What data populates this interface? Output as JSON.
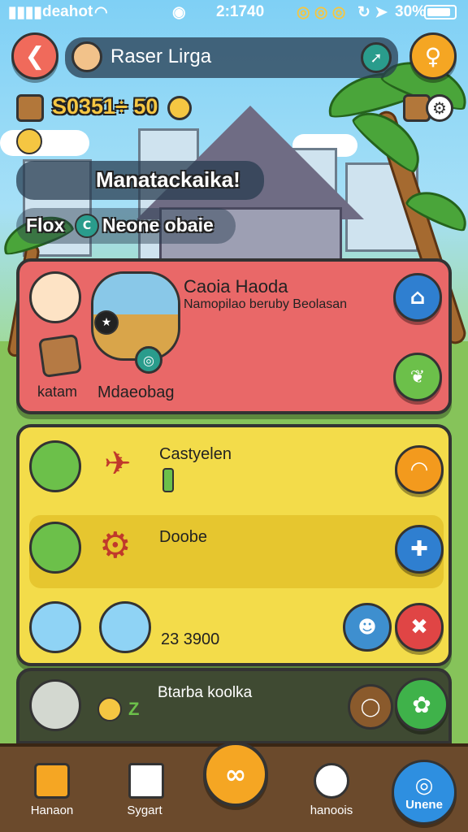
{
  "status_bar": {
    "carrier": "deahot",
    "time": "2:1740",
    "battery": "30%"
  },
  "header": {
    "player_name": "Raser Lirga",
    "back_icon": "chevron-left-icon",
    "profile_icon": "map-pin-icon"
  },
  "resources": {
    "coins": "S0351÷ 50"
  },
  "banner": {
    "title": "Manatackaika!",
    "subtitle": "Flox",
    "subtitle_tag": "Neone obaie"
  },
  "featured_card": {
    "title": "Caoia Haoda",
    "subtitle": "Namopilao beruby Beolasan",
    "item_left_label": "katam",
    "item_right_label": "Mdaeobag",
    "color": "#e96868"
  },
  "list": [
    {
      "name": "Castyelen",
      "value": "",
      "action_icon": "wifi-icon",
      "action_color": "#f39a1d"
    },
    {
      "name": "Doobe",
      "value": "",
      "action_icon": "plus-icon",
      "action_color": "#2f7fd0"
    },
    {
      "name": "",
      "value": "23 3900",
      "action_icon": "close-icon",
      "action_color": "#e04545"
    }
  ],
  "bottom_card": {
    "title": "Btarba koolka",
    "badge": "Z"
  },
  "nav": {
    "items": [
      {
        "label": "Hanaon",
        "icon": "house-icon"
      },
      {
        "label": "Sygart",
        "icon": "tool-icon"
      },
      {
        "label": "",
        "icon": "center-action-icon"
      },
      {
        "label": "hanoois",
        "icon": "gift-icon"
      },
      {
        "label": "Unene",
        "icon": "chat-icon"
      }
    ]
  }
}
